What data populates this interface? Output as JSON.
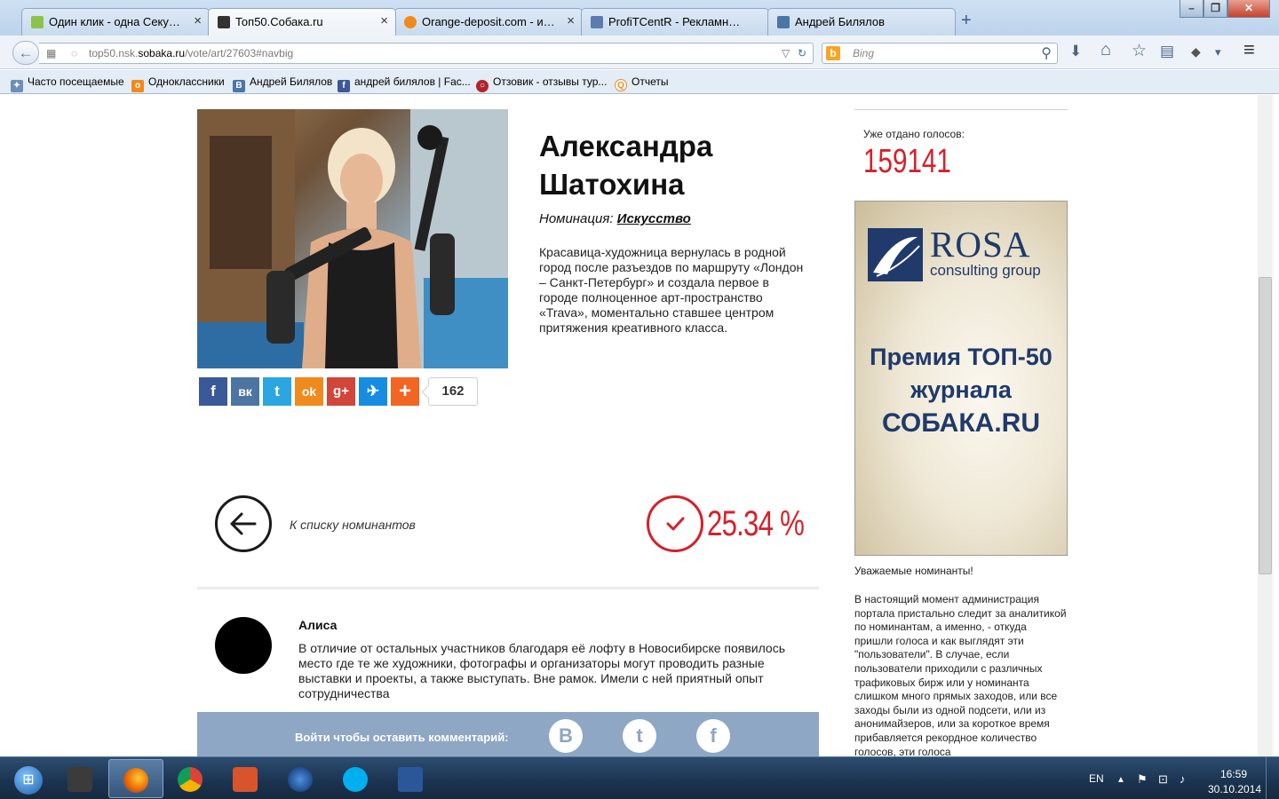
{
  "tabs": [
    {
      "title": "Один клик - одна Секунда",
      "favicon_color": "#8bc34a",
      "active": false
    },
    {
      "title": "Топ50.Собака.ru",
      "favicon_color": "#333333",
      "active": true
    },
    {
      "title": "Orange-deposit.com - игр...",
      "favicon_color": "#f08a1c",
      "active": false
    },
    {
      "title": "ProfiTCentR - Рекламное ...",
      "favicon_color": "#5c7cb0",
      "active": false
    },
    {
      "title": "Андрей Билялов",
      "favicon_color": "#4a76a8",
      "active": false
    }
  ],
  "tab_close_glyph": "×",
  "new_tab_glyph": "+",
  "window_controls": {
    "minimize": "–",
    "maximize": "❐",
    "close": "✕"
  },
  "address_bar": {
    "url_prefix": "top50.nsk.",
    "url_domain": "sobaka.ru",
    "url_suffix": "/vote/art/27603#navbig"
  },
  "search_bar": {
    "placeholder": "Bing",
    "engine_glyph": "b"
  },
  "bookmarks": [
    {
      "label": "Часто посещаемые",
      "icon": "bookmark-icon",
      "icon_color": "#6a8fb8",
      "glyph": "✦"
    },
    {
      "label": "Одноклассники",
      "icon": "odnoklassniki-icon",
      "icon_color": "#f08a1c",
      "glyph": "o"
    },
    {
      "label": "Андрей Билялов",
      "icon": "vk-icon",
      "icon_color": "#4a76a8",
      "glyph": "B"
    },
    {
      "label": "андрей билялов | Fac...",
      "icon": "facebook-icon",
      "icon_color": "#3b5998",
      "glyph": "f"
    },
    {
      "label": "Отзовик - отзывы тур...",
      "icon": "otzovik-icon",
      "icon_color": "#b0232a",
      "glyph": "○"
    },
    {
      "label": "Отчеты",
      "icon": "reports-icon",
      "icon_color": "#f08a1c",
      "glyph": "Q"
    }
  ],
  "nominee": {
    "name": "Александра Шатохина",
    "nomination_label": "Номинация:",
    "nomination_value": "Искусство",
    "description": "Красавица-художница вернулась в родной город после разъездов по маршруту «Лондон – Санкт-Петербург» и создала первое в городе  полноценное арт-пространство «Trava», моментально ставшее центром притяжения креативного класса."
  },
  "share": {
    "buttons": [
      {
        "name": "facebook",
        "glyph": "f",
        "color": "#3b5998"
      },
      {
        "name": "vkontakte",
        "glyph": "вк",
        "color": "#4c75a3"
      },
      {
        "name": "twitter",
        "glyph": "t",
        "color": "#2ba6e1"
      },
      {
        "name": "odnoklassniki",
        "glyph": "ok",
        "color": "#f08a1c"
      },
      {
        "name": "google-plus",
        "glyph": "g+",
        "color": "#d1453b"
      },
      {
        "name": "moimir",
        "glyph": "✈",
        "color": "#168de2"
      },
      {
        "name": "more",
        "glyph": "+",
        "color": "#f26522"
      }
    ],
    "count": "162"
  },
  "back_to_list": {
    "label": "К списку номинантов",
    "glyph": "←"
  },
  "vote": {
    "percent": "25.34 %",
    "glyph": "✓"
  },
  "comment": {
    "author": "Алиса",
    "text": "В отличие от остальных участников благодаря её лофту в Новосибирске появилось место где те же художники, фотографы и организаторы могут проводить разные выставки и проекты, а также выступать. Вне рамок. Имели с ней приятный опыт сотрудничества"
  },
  "login_bar": {
    "label": "Войти чтобы оставить комментарий:",
    "icons": [
      {
        "name": "vk",
        "glyph": "B"
      },
      {
        "name": "twitter",
        "glyph": "t"
      },
      {
        "name": "facebook",
        "glyph": "f"
      }
    ]
  },
  "sidebar": {
    "votes_label": "Уже отдано голосов:",
    "votes_count": "159141",
    "ad": {
      "brand": "ROSA",
      "brand_sub": "consulting group",
      "headline_1": "Премия ТОП-50",
      "headline_2": "журнала",
      "headline_3": "СОБАКА.RU"
    },
    "notice_title": "Уважаемые номинанты!",
    "notice_body": "В настоящий момент администрация портала пристально следит за аналитикой по номинантам, а именно, - откуда пришли голоса и как выглядят эти \"пользователи\". В случае, если пользователи приходили с различных трафиковых бирж или у номинанта слишком много прямых заходов, или все заходы были из одной подсети, или из анонимайзеров, или за короткое время прибавляется рекордное количество голосов, эти голоса"
  },
  "taskbar": {
    "apps": [
      {
        "name": "explorer",
        "color": "#3b3b3b",
        "active": false
      },
      {
        "name": "firefox",
        "color": "#e66000",
        "active": true
      },
      {
        "name": "chrome",
        "color": "#3aa757",
        "active": false
      },
      {
        "name": "viewer",
        "color": "#d9532c",
        "active": false
      },
      {
        "name": "media-player",
        "color": "#1a5fb4",
        "active": false
      },
      {
        "name": "skype",
        "color": "#00aff0",
        "active": false
      },
      {
        "name": "word",
        "color": "#2b579a",
        "active": false
      }
    ],
    "language": "EN",
    "time": "16:59",
    "date": "30.10.2014",
    "start_glyph": "⊞",
    "tray_glyphs": {
      "up": "▲",
      "flag": "⚑",
      "network": "⊡",
      "volume": "♪"
    }
  },
  "toolbar_glyphs": {
    "back": "←",
    "url_dropdown": "▽",
    "reload": "↻",
    "search": "⚲",
    "download": "⬇",
    "home": "⌂",
    "star": "☆",
    "reader": "▤",
    "extension": "◆",
    "menu_arrow": "▾",
    "menu": "≡",
    "url_page": "▦",
    "url_globe": "◌"
  },
  "colors": {
    "accent_red": "#d6202a",
    "login_bar": "#8da7c4",
    "ad_blue": "#1f3a6b"
  }
}
